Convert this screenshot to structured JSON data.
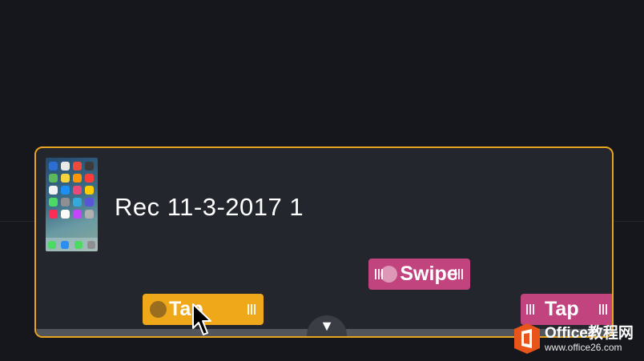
{
  "recording": {
    "title": "Rec 11-3-2017 1",
    "selected": true,
    "accent_color": "#e8a31f"
  },
  "gestures": [
    {
      "label": "Swipe",
      "color": "#c2447e"
    },
    {
      "label": "Tap",
      "color": "#f0a81b",
      "selected": true
    },
    {
      "label": "Tap",
      "color": "#c2447e"
    }
  ],
  "timeline": {
    "handle_icon": "triangle-down-icon",
    "handle_glyph": "▼"
  },
  "watermark": {
    "line1": "Office教程网",
    "line2": "www.office26.com"
  }
}
